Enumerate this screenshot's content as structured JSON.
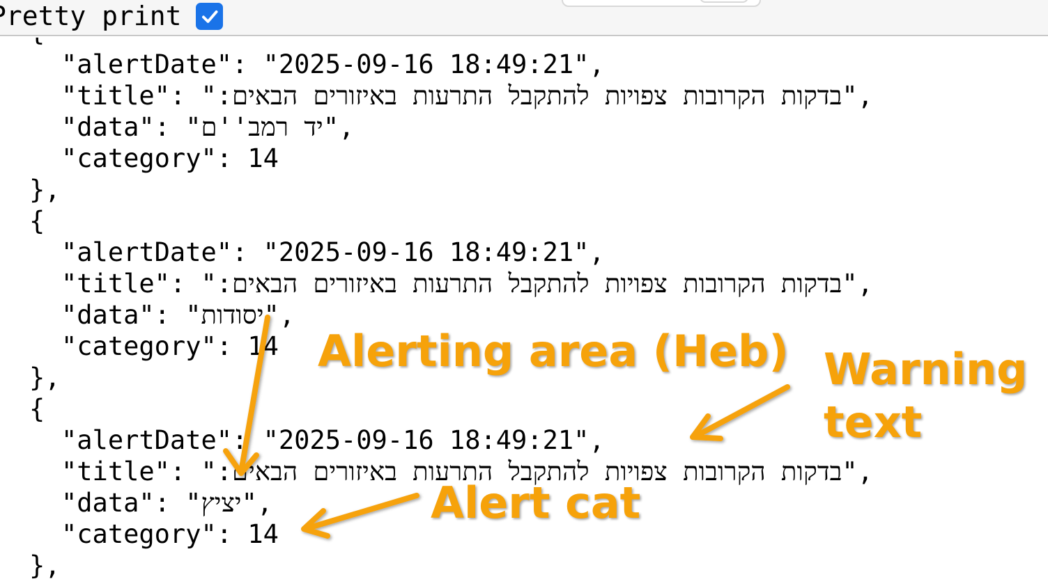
{
  "toolbar": {
    "pretty_print_label": "Pretty print",
    "pretty_print_checked": true
  },
  "json_view": {
    "partial_open_brace": "{",
    "records": [
      {
        "open": "{",
        "alertDate_key": "\"alertDate\"",
        "alertDate_value": "\"2025-09-16 18:49:21\"",
        "title_key": "\"title\"",
        "title_value": "בדקות הקרובות צפויות להתקבל התרעות באיזורים הבאים:",
        "data_key": "\"data\"",
        "data_value": "יד רמב''ם",
        "category_key": "\"category\"",
        "category_value": "14",
        "close": "},"
      },
      {
        "open": "{",
        "alertDate_key": "\"alertDate\"",
        "alertDate_value": "\"2025-09-16 18:49:21\"",
        "title_key": "\"title\"",
        "title_value": "בדקות הקרובות צפויות להתקבל התרעות באיזורים הבאים:",
        "data_key": "\"data\"",
        "data_value": "יסודות",
        "category_key": "\"category\"",
        "category_value": "14",
        "close": "},"
      },
      {
        "open": "{",
        "alertDate_key": "\"alertDate\"",
        "alertDate_value": "\"2025-09-16 18:49:21\"",
        "title_key": "\"title\"",
        "title_value": "בדקות הקרובות צפויות להתקבל התרעות באיזורים הבאים:",
        "data_key": "\"data\"",
        "data_value": "יציץ",
        "category_key": "\"category\"",
        "category_value": "14",
        "close": "},"
      }
    ]
  },
  "annotations": {
    "color": "#f6a20a",
    "alerting_area": "Alerting area (Heb)",
    "warning_text_line1": "Warning",
    "warning_text_line2": "text",
    "alert_cat": "Alert cat"
  },
  "colors": {
    "checkbox": "#1a73e8",
    "annotation": "#f6a20a"
  }
}
